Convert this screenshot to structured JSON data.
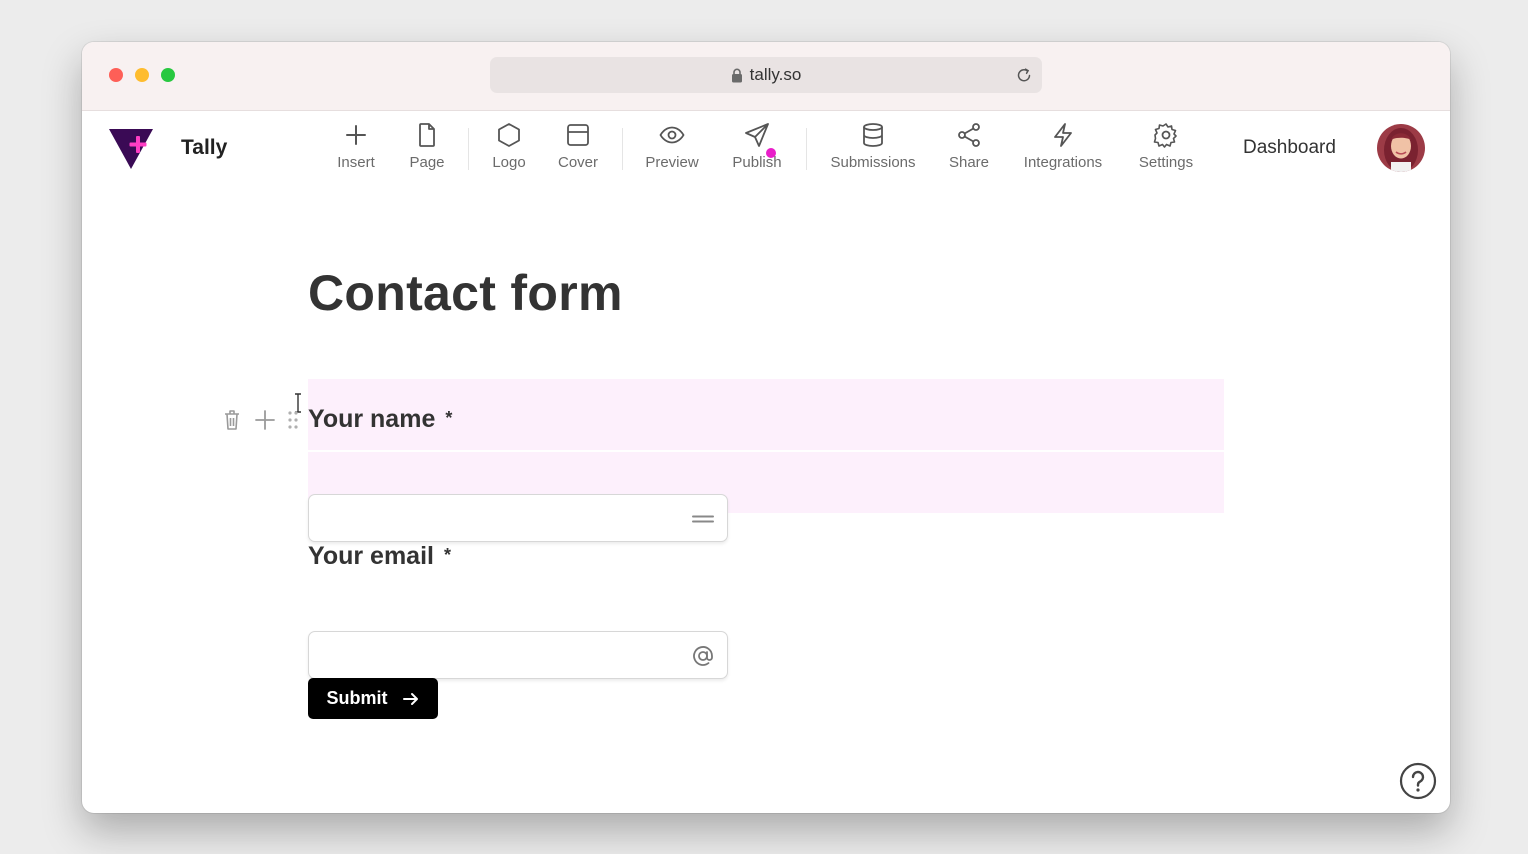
{
  "browser": {
    "url": "tally.so"
  },
  "app": {
    "brand": "Tally",
    "dashboard_label": "Dashboard"
  },
  "toolbar": {
    "items": [
      {
        "label": "Insert",
        "icon": "plus-icon"
      },
      {
        "label": "Page",
        "icon": "page-icon"
      },
      {
        "label": "Logo",
        "icon": "hexagon-icon"
      },
      {
        "label": "Cover",
        "icon": "cover-icon"
      },
      {
        "label": "Preview",
        "icon": "eye-icon"
      },
      {
        "label": "Publish",
        "icon": "send-icon"
      },
      {
        "label": "Submissions",
        "icon": "database-icon"
      },
      {
        "label": "Share",
        "icon": "share-icon"
      },
      {
        "label": "Integrations",
        "icon": "lightning-icon"
      },
      {
        "label": "Settings",
        "icon": "gear-icon"
      }
    ]
  },
  "form": {
    "title": "Contact form",
    "questions": [
      {
        "label": "Your name",
        "required_mark": "*",
        "value": "",
        "icon": "short-text-icon"
      },
      {
        "label": "Your email",
        "required_mark": "*",
        "value": "",
        "icon": "at-icon"
      }
    ],
    "submit_label": "Submit"
  },
  "colors": {
    "accent": "#e91ec9",
    "brand_dark": "#3a0a55",
    "block_highlight": "#fdf0fc"
  }
}
